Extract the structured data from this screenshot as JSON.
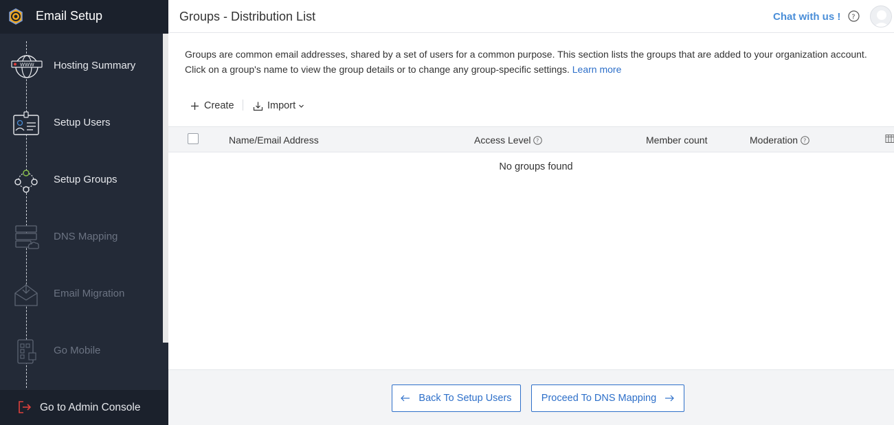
{
  "sidebar": {
    "title": "Email Setup",
    "steps": [
      {
        "label": "Hosting Summary",
        "state": "active"
      },
      {
        "label": "Setup Users",
        "state": "active"
      },
      {
        "label": "Setup Groups",
        "state": "active"
      },
      {
        "label": "DNS Mapping",
        "state": "disabled"
      },
      {
        "label": "Email Migration",
        "state": "disabled"
      },
      {
        "label": "Go Mobile",
        "state": "disabled"
      }
    ],
    "footer_label": "Go to Admin Console"
  },
  "header": {
    "title": "Groups - Distribution List",
    "chat_label": "Chat with us !"
  },
  "description": {
    "text": "Groups are common email addresses, shared by a set of users for a common purpose. This section lists the groups that are added to your organization account. Click on a group's name to view the group details or to change any group-specific settings.",
    "link": "Learn more"
  },
  "toolbar": {
    "create_label": "Create",
    "import_label": "Import"
  },
  "table": {
    "columns": {
      "name": "Name/Email Address",
      "access": "Access Level",
      "members": "Member count",
      "moderation": "Moderation"
    },
    "empty_text": "No groups found"
  },
  "footer": {
    "back_label": "Back To Setup Users",
    "proceed_label": "Proceed To DNS Mapping"
  },
  "colors": {
    "sidebar_bg": "#232a37",
    "accent": "#2d6fc9",
    "chat": "#4a8ed8",
    "admin_icon": "#e0403c"
  },
  "icons": {
    "logo": "gear-envelope-icon",
    "hosting": "globe-www-icon",
    "users": "id-card-icon",
    "groups": "network-people-icon",
    "dns": "server-cloud-icon",
    "migration": "envelope-download-icon",
    "mobile": "phone-apps-icon",
    "admin": "exit-icon"
  }
}
